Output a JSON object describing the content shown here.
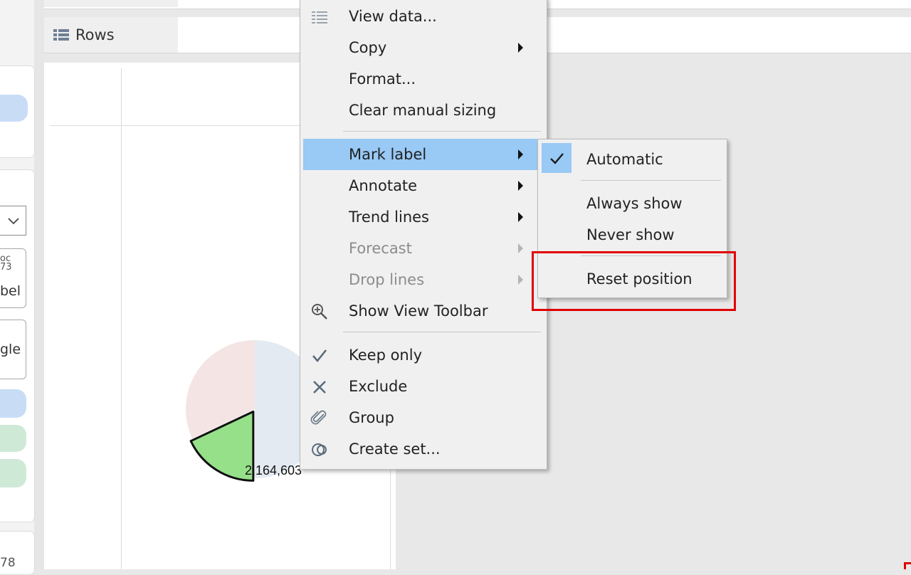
{
  "shelves": {
    "rows_label": "Rows"
  },
  "left_panel": {
    "card_a_text": "oc\n73",
    "card_a_label": "bel",
    "card_b_label": "gle",
    "bottom_text": "78"
  },
  "view": {
    "data_label": "2,164,603"
  },
  "context_menu": {
    "items": [
      {
        "label": "View data...",
        "icon": "view-data-icon",
        "submenu": false,
        "disabled": false
      },
      {
        "label": "Copy",
        "submenu": true,
        "disabled": false
      },
      {
        "label": "Format...",
        "submenu": false,
        "disabled": false
      },
      {
        "label": "Clear manual sizing",
        "submenu": false,
        "disabled": false
      },
      {
        "label": "Mark label",
        "submenu": true,
        "disabled": false,
        "highlighted": true
      },
      {
        "label": "Annotate",
        "submenu": true,
        "disabled": false
      },
      {
        "label": "Trend lines",
        "submenu": true,
        "disabled": false
      },
      {
        "label": "Forecast",
        "submenu": true,
        "disabled": true
      },
      {
        "label": "Drop lines",
        "submenu": true,
        "disabled": true
      },
      {
        "label": "Show View Toolbar",
        "icon": "zoom-in-icon",
        "submenu": false,
        "disabled": false
      },
      {
        "label": "Keep only",
        "icon": "checkmark-icon",
        "submenu": false,
        "disabled": false
      },
      {
        "label": "Exclude",
        "icon": "close-icon",
        "submenu": false,
        "disabled": false
      },
      {
        "label": "Group",
        "icon": "paperclip-icon",
        "submenu": false,
        "disabled": false
      },
      {
        "label": "Create set...",
        "icon": "create-set-icon",
        "submenu": false,
        "disabled": false
      }
    ]
  },
  "mark_label_submenu": {
    "items": [
      {
        "label": "Automatic",
        "checked": true
      },
      {
        "label": "Always show",
        "checked": false
      },
      {
        "label": "Never show",
        "checked": false
      },
      {
        "label": "Reset position",
        "checked": false
      }
    ]
  },
  "chart_data": {
    "type": "pie",
    "series": [
      {
        "values": [
          0.5,
          0.18,
          0.32
        ]
      }
    ],
    "colors": [
      "#e4eaf2",
      "#96e08a",
      "#f4e4e4"
    ],
    "data_labels": [
      "2,164,603"
    ],
    "selected_slice": 1
  },
  "colors": {
    "menu_highlight": "#99c9f5",
    "annotation_red": "#e00000",
    "menu_background": "#f0f0f0"
  }
}
